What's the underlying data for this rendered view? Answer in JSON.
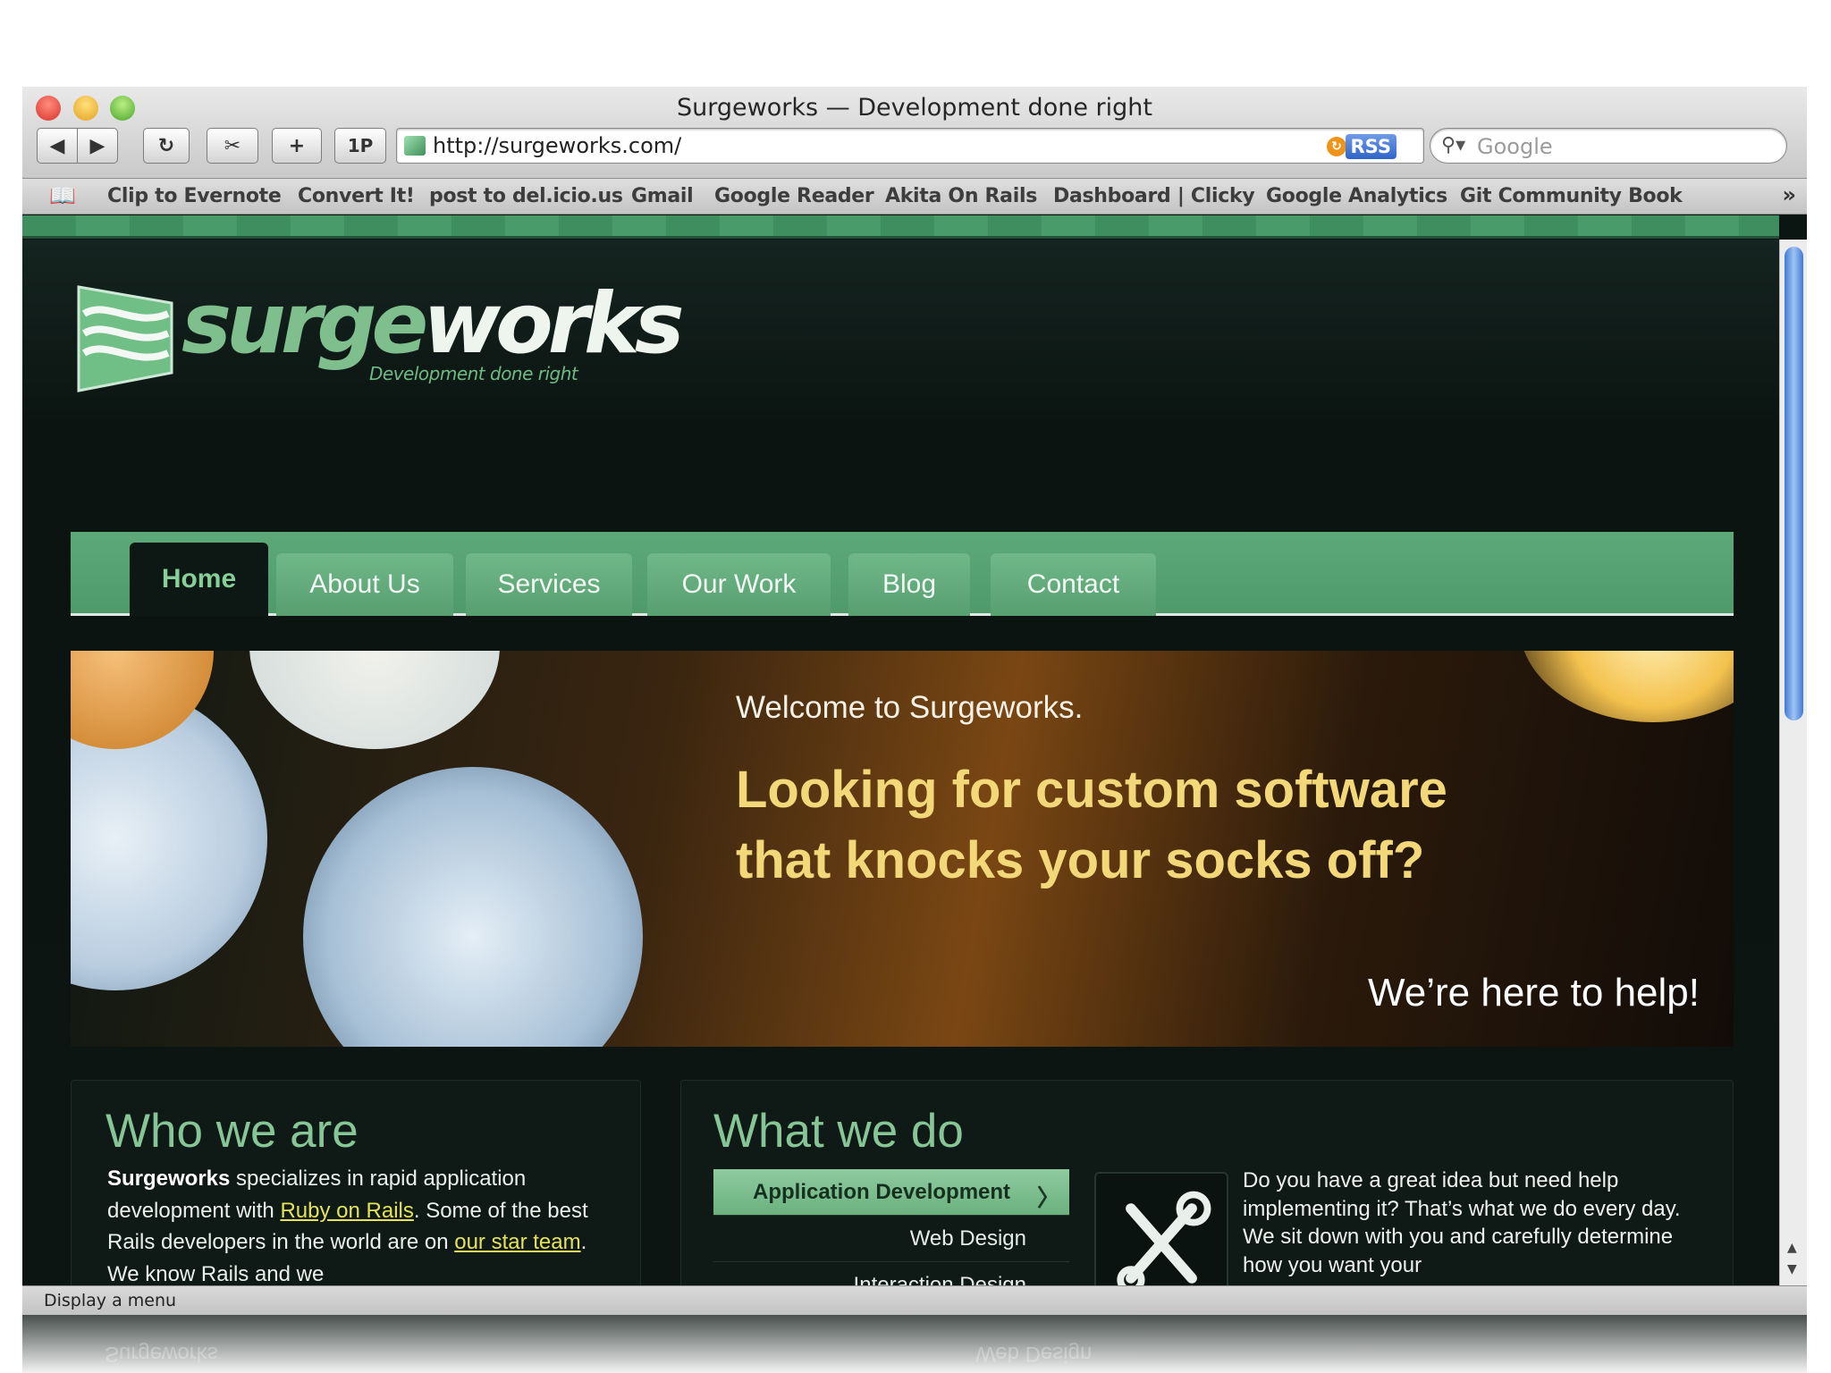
{
  "window": {
    "title": "Surgeworks — Development done right"
  },
  "toolbar": {
    "back": "◀",
    "forward": "▶",
    "reload": "↻",
    "snip": "✂",
    "add": "+",
    "onepassword": "1P",
    "url": "http://surgeworks.com/",
    "rss_label": "RSS",
    "search_placeholder": "Google"
  },
  "bookmarks": {
    "items": [
      "Clip to Evernote",
      "Convert It!",
      "post to del.icio.us",
      "Gmail",
      "Google Reader",
      "Akita On Rails",
      "Dashboard | Clicky",
      "Google Analytics",
      "Git Community Book"
    ],
    "more": "»"
  },
  "site": {
    "logo": {
      "part1": "surge",
      "part2": "works",
      "tagline": "Development done right"
    },
    "nav": [
      "Home",
      "About Us",
      "Services",
      "Our Work",
      "Blog",
      "Contact"
    ],
    "hero": {
      "welcome": "Welcome to Surgeworks.",
      "headline": "Looking for custom software that knocks your socks off?",
      "help": "We’re here to help!"
    },
    "who": {
      "title": "Who we are",
      "brand": "Surgeworks",
      "text1": " specializes in rapid application development with ",
      "link1": "Ruby on Rails",
      "text2": ". Some of the best Rails developers in the world are on ",
      "link2": "our star team",
      "text3": ". We know Rails and we"
    },
    "what": {
      "title": "What we do",
      "services": [
        "Application Development",
        "Web Design",
        "Interaction Design"
      ],
      "body": "Do you have a great idea but need help implementing it? That’s what we do every day. We sit down with you and carefully determine how you want your"
    }
  },
  "status": {
    "text": "Display a menu"
  },
  "colors": {
    "accent_green": "#5ea979",
    "headline_yellow": "#f2d878",
    "link_yellow": "#e4e35a"
  },
  "icons": [
    "search-icon",
    "rss-icon",
    "bookmarks-book-icon",
    "tools-icon",
    "chevron-right-icon"
  ]
}
